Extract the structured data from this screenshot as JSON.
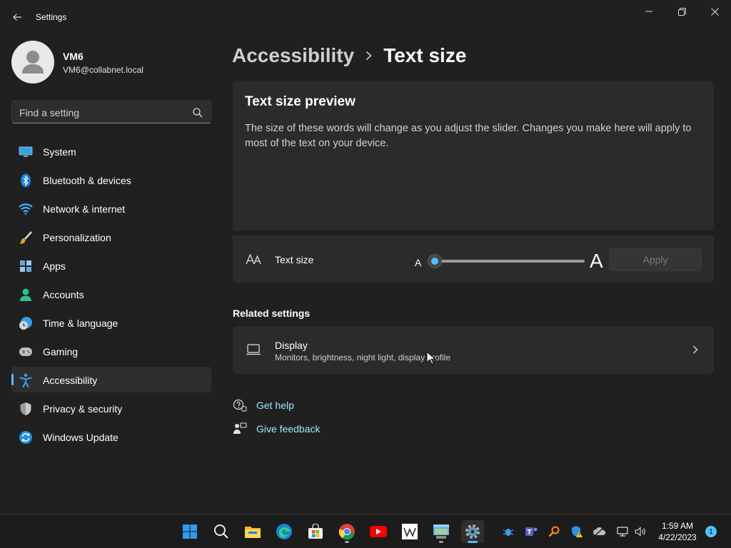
{
  "window": {
    "app_title": "Settings",
    "back_icon": "back-arrow-icon",
    "controls": [
      "minimize-icon",
      "restore-icon",
      "close-icon"
    ]
  },
  "profile": {
    "name": "VM6",
    "email": "VM6@collabnet.local"
  },
  "search": {
    "placeholder": "Find a setting"
  },
  "sidebar": {
    "items": [
      {
        "label": "System",
        "icon": "system-icon"
      },
      {
        "label": "Bluetooth & devices",
        "icon": "bluetooth-icon"
      },
      {
        "label": "Network & internet",
        "icon": "wifi-icon"
      },
      {
        "label": "Personalization",
        "icon": "brush-icon"
      },
      {
        "label": "Apps",
        "icon": "apps-icon"
      },
      {
        "label": "Accounts",
        "icon": "accounts-icon"
      },
      {
        "label": "Time & language",
        "icon": "clock-globe-icon"
      },
      {
        "label": "Gaming",
        "icon": "gamepad-icon"
      },
      {
        "label": "Accessibility",
        "icon": "accessibility-icon",
        "active": true
      },
      {
        "label": "Privacy & security",
        "icon": "shield-icon"
      },
      {
        "label": "Windows Update",
        "icon": "update-icon"
      }
    ]
  },
  "breadcrumb": {
    "parent": "Accessibility",
    "current": "Text size"
  },
  "preview": {
    "title": "Text size preview",
    "body": "The size of these words will change as you adjust the slider. Changes you make here will apply to most of the text on your device."
  },
  "text_size": {
    "label": "Text size",
    "min_label": "A",
    "max_label": "A",
    "slider_value_percent": 100,
    "apply_label": "Apply"
  },
  "related": {
    "heading": "Related settings",
    "display_title": "Display",
    "display_subtitle": "Monitors, brightness, night light, display profile"
  },
  "help": {
    "get_help": "Get help",
    "give_feedback": "Give feedback"
  },
  "taskbar": {
    "apps": [
      "windows-start-icon",
      "search-icon",
      "file-explorer-icon",
      "edge-icon",
      "store-icon",
      "chrome-icon",
      "youtube-icon",
      "wikipedia-icon",
      "remote-desktop-icon",
      "settings-icon"
    ],
    "tray": [
      "bug-icon",
      "teams-icon",
      "search-tool-icon",
      "defender-warning-icon",
      "onedrive-icon",
      "network-icon",
      "volume-icon"
    ],
    "time": "1:59 AM",
    "date": "4/22/2023",
    "notification_count": "1"
  },
  "colors": {
    "accent": "#4cc2ff",
    "link": "#99ebff",
    "background": "#202020",
    "card": "#2b2b2b"
  }
}
